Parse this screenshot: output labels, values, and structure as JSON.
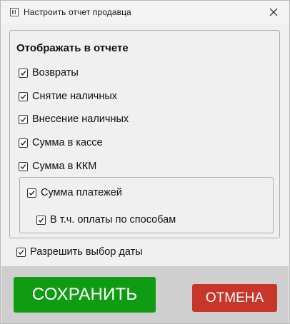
{
  "window": {
    "title": "Настроить отчет продавца"
  },
  "group": {
    "title": "Отображать в отчете",
    "items": [
      {
        "label": "Возвраты",
        "checked": true
      },
      {
        "label": "Снятие наличных",
        "checked": true
      },
      {
        "label": "Внесение наличных",
        "checked": true
      },
      {
        "label": "Сумма в кассе",
        "checked": true
      },
      {
        "label": "Сумма в ККМ",
        "checked": true
      }
    ],
    "payments": {
      "label": "Сумма платежей",
      "checked": true,
      "sub_label": "В т.ч. оплаты по способам",
      "sub_checked": true
    }
  },
  "allow_date": {
    "label": "Разрешить выбор даты",
    "checked": true
  },
  "buttons": {
    "save": "СОХРАНИТЬ",
    "cancel": "ОТМЕНА"
  },
  "colors": {
    "save_bg": "#109c12",
    "cancel_bg": "#c8352a",
    "footer_bg": "#cfcfcf"
  }
}
